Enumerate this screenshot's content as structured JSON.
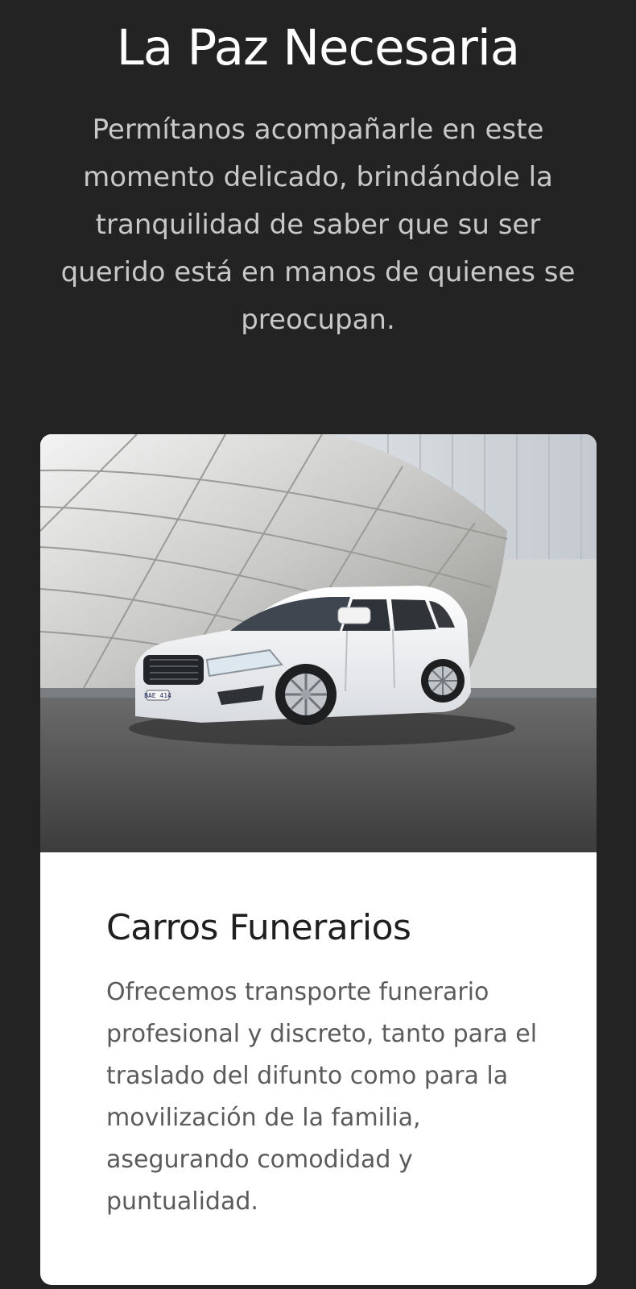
{
  "hero": {
    "title": "La Paz Necesaria",
    "text": "Permítanos acompañarle en este momento delicado, brindándole la tranquilidad de saber que su ser querido está en manos de quienes se preocupan."
  },
  "card": {
    "image_alt": "Minivan blanca estacionada frente a un edificio de fachada metálica",
    "plate": "BAE 414",
    "title": "Carros Funerarios",
    "text": "Ofrecemos transporte funerario profesional y discreto, tanto para el traslado del difunto como para la movilización de la familia, asegurando comodidad y puntualidad."
  },
  "colors": {
    "background": "#232323",
    "card": "#ffffff",
    "title": "#1f1f1f",
    "body_text": "#5b5b5b",
    "hero_text": "#c8c8c8"
  }
}
